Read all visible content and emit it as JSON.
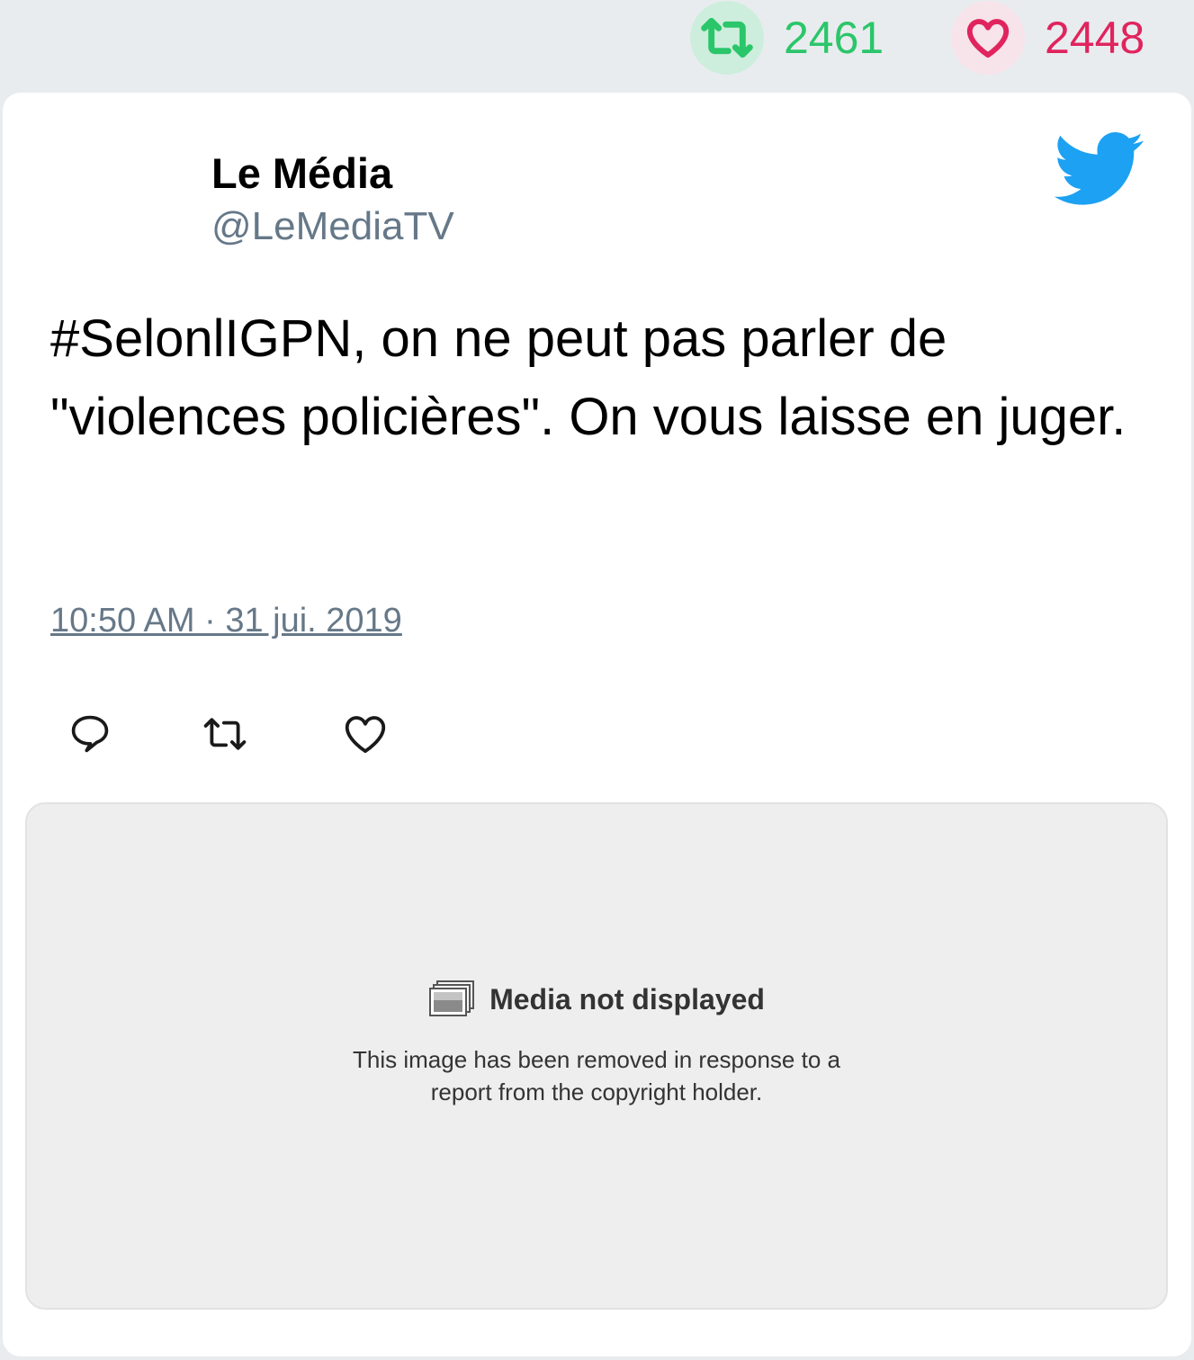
{
  "stats": {
    "retweet_count": "2461",
    "like_count": "2448",
    "retweet_color": "#2bc66a",
    "like_color": "#e0245e"
  },
  "tweet": {
    "author_name": "Le Média",
    "author_handle": "@LeMediaTV",
    "text": "#SelonlIGPN, on ne peut pas parler de \"violences policières\". On vous laisse en juger.",
    "timestamp": "10:50 AM · 31 jui. 2019",
    "brand_icon": "twitter-bird-icon",
    "brand_color": "#1da1f2"
  },
  "actions": {
    "reply_icon": "reply-icon",
    "retweet_icon": "retweet-icon",
    "like_icon": "heart-icon"
  },
  "media": {
    "icon": "media-placeholder-icon",
    "title": "Media not displayed",
    "description_line1": "This image has been removed in response to a",
    "description_line2": "report from the copyright holder."
  }
}
